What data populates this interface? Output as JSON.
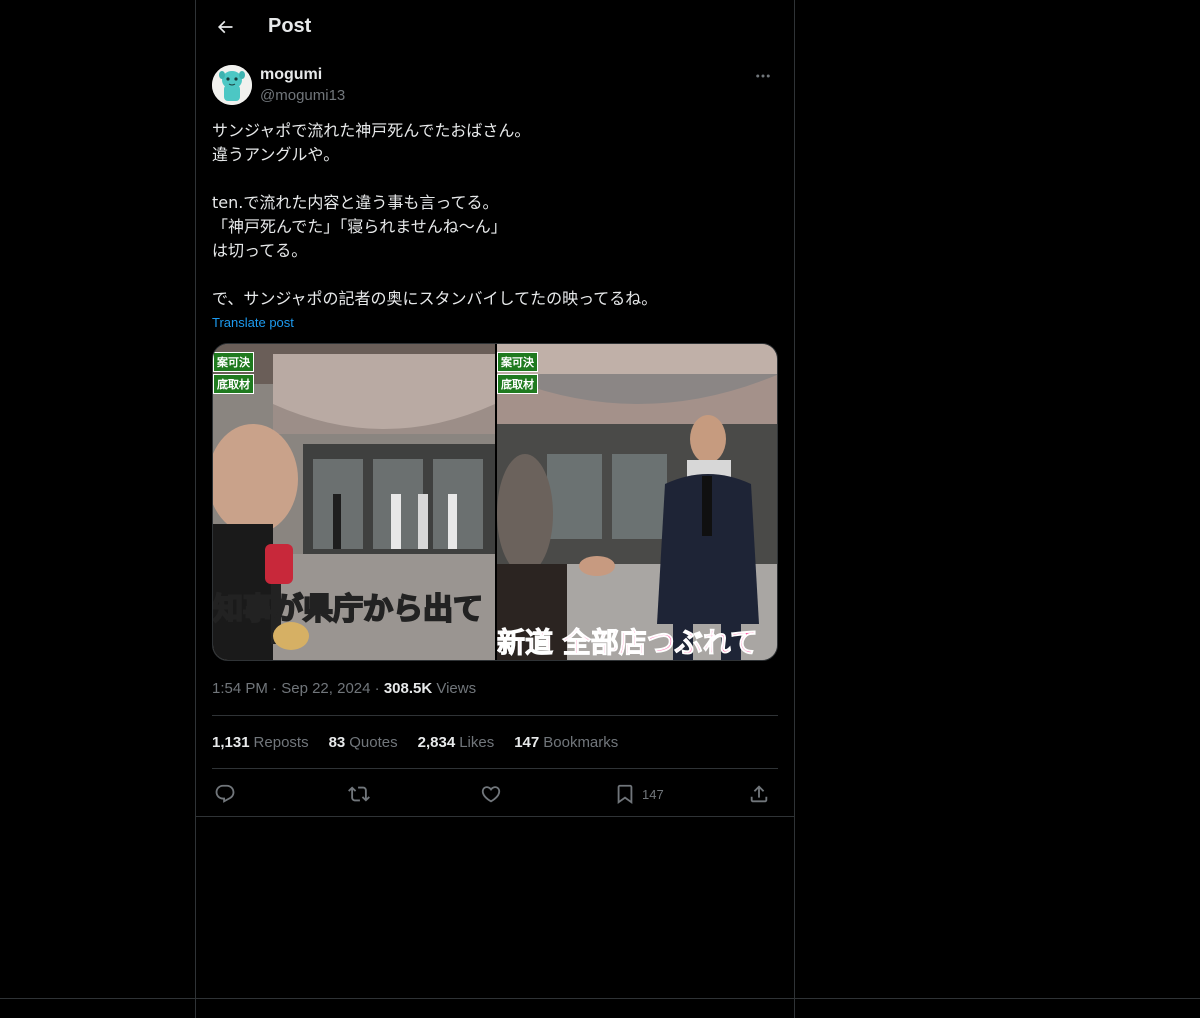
{
  "header": {
    "title": "Post"
  },
  "author": {
    "display_name": "mogumi",
    "handle": "@mogumi13"
  },
  "post": {
    "text": "サンジャポで流れた神戸死んでたおばさん。\n違うアングルや。\n\nten.で流れた内容と違う事も言ってる。\n「神戸死んでた」「寝られませんね〜ん」\nは切ってる。\n\nで、サンジャポの記者の奥にスタンバイしてたの映ってるね。",
    "translate_label": "Translate post"
  },
  "media": {
    "left": {
      "tag_top": "案可決",
      "tag_bottom": "底取材",
      "caption": "知事が県庁から出て"
    },
    "right": {
      "tag_top": "案可決",
      "tag_bottom": "底取材",
      "caption": "新道 全部店つぶれて"
    }
  },
  "meta": {
    "time": "1:54 PM",
    "date": "Sep 22, 2024",
    "views_count": "308.5K",
    "views_label": "Views"
  },
  "stats": {
    "reposts_count": "1,131",
    "reposts_label": "Reposts",
    "quotes_count": "83",
    "quotes_label": "Quotes",
    "likes_count": "2,834",
    "likes_label": "Likes",
    "bookmarks_count": "147",
    "bookmarks_label": "Bookmarks"
  },
  "actions": {
    "bookmark_count": "147"
  },
  "icons": {
    "back": "arrow-left-icon",
    "more": "more-horizontal-icon",
    "reply": "reply-icon",
    "repost": "repost-icon",
    "like": "heart-icon",
    "bookmark": "bookmark-icon",
    "share": "share-icon"
  },
  "colors": {
    "background": "#000000",
    "text": "#e7e9ea",
    "muted": "#71767b",
    "link": "#1d9bf0",
    "border": "#2f3336"
  }
}
